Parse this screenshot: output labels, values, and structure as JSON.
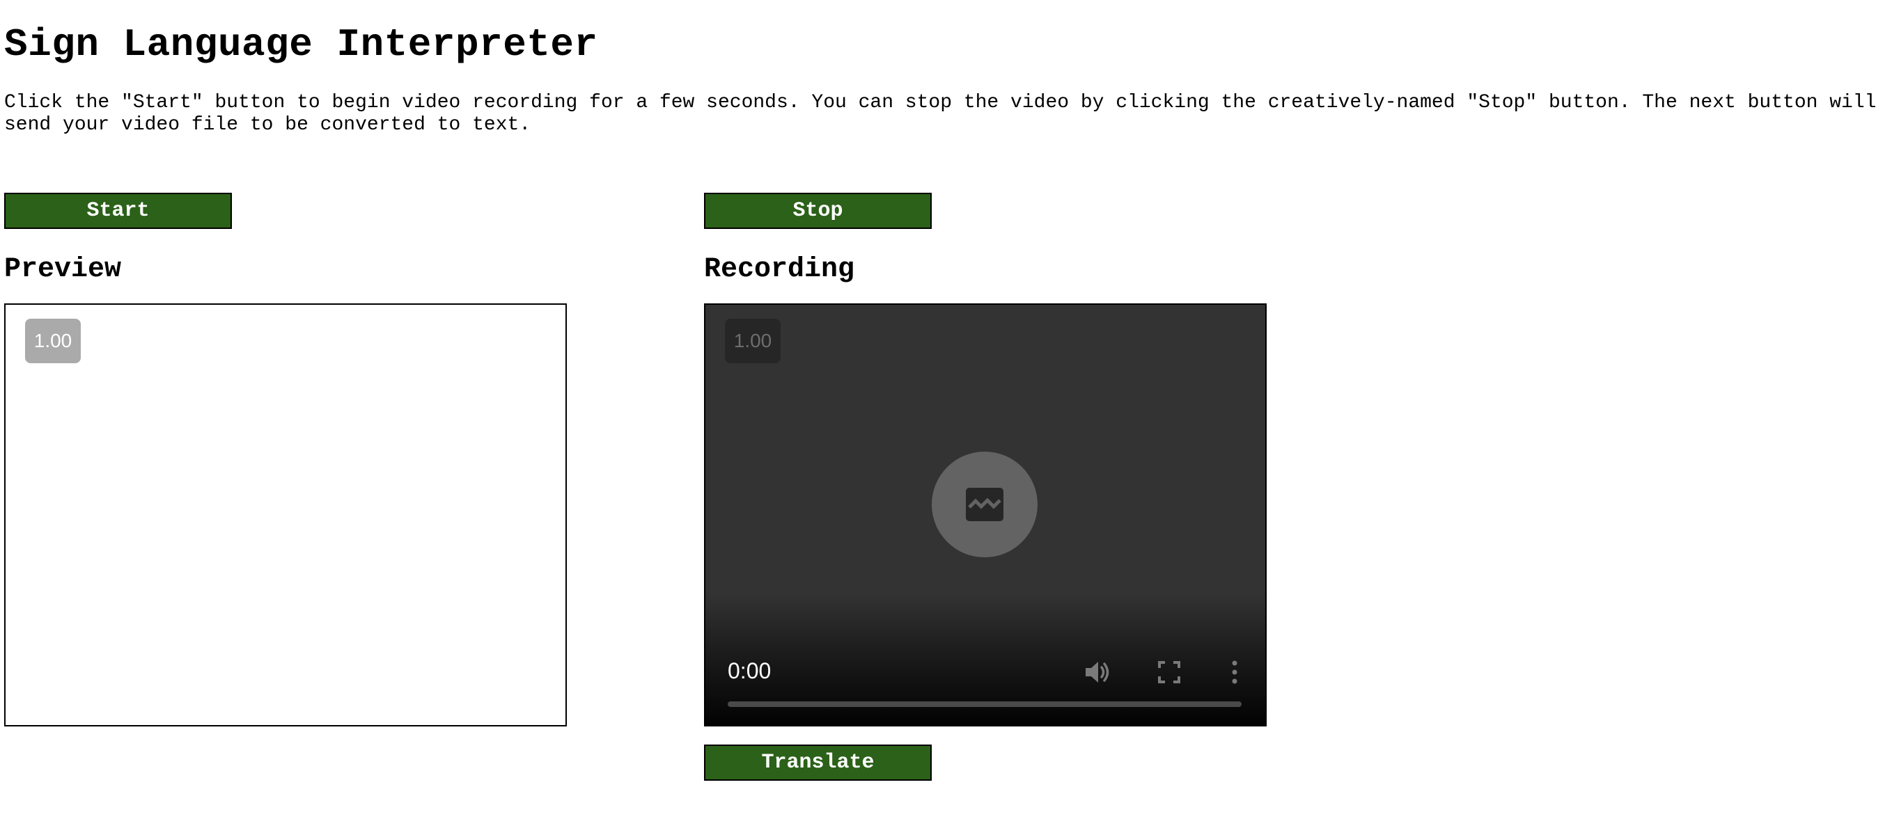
{
  "page": {
    "title": "Sign Language Interpreter",
    "intro": "Click the \"Start\" button to begin video recording for a few seconds. You can stop the video by clicking the creatively-named \"Stop\" button. The next button will send your video file to be converted to text."
  },
  "controls": {
    "start_label": "Start",
    "stop_label": "Stop",
    "translate_label": "Translate"
  },
  "preview": {
    "heading": "Preview",
    "playback_rate": "1.00"
  },
  "recording": {
    "heading": "Recording",
    "playback_rate": "1.00",
    "current_time": "0:00",
    "progress": 0,
    "icons": [
      "broken-media-icon",
      "volume-icon",
      "fullscreen-icon",
      "more-vertical-icon"
    ]
  },
  "colors": {
    "button_bg": "#2b6118",
    "button_text": "#ffffff",
    "player_bg": "#333333"
  }
}
